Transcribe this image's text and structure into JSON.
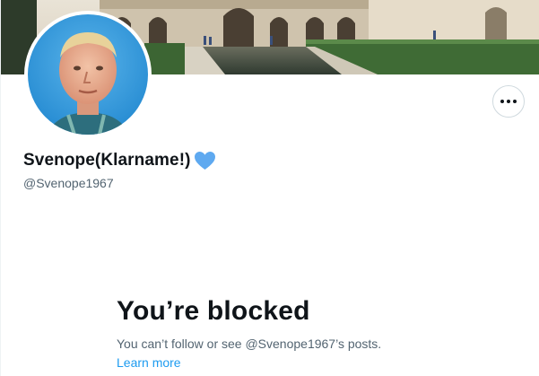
{
  "profile": {
    "display_name": "Svenope(Klarname!)",
    "handle": "@Svenope1967",
    "name_emoji": "blue-heart-icon",
    "avatar": "profile-avatar-photo",
    "banner": "profile-banner-photo"
  },
  "actions": {
    "more_icon": "more-horizontal-icon"
  },
  "blocked": {
    "title": "You’re blocked",
    "description": "You can’t follow or see @Svenope1967’s posts.",
    "learn_more": "Learn more"
  },
  "colors": {
    "text_primary": "#0f1419",
    "text_secondary": "#536471",
    "link": "#1d9bf0",
    "heart": "#5ea9f0",
    "border": "#cfd9de"
  }
}
